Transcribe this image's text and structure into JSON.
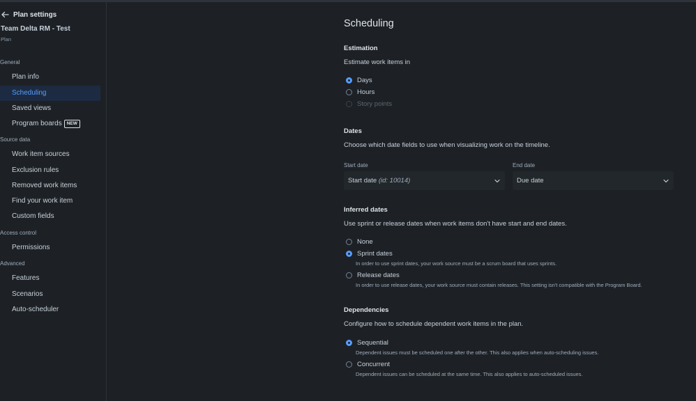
{
  "sidebar": {
    "back_label": "Plan settings",
    "plan_name": "Team Delta RM - Test",
    "plan_type": "Plan",
    "sections": [
      {
        "title": "General"
      },
      {
        "title": "Source data"
      },
      {
        "title": "Access control"
      },
      {
        "title": "Advanced"
      }
    ],
    "items": [
      {
        "label": "Plan info"
      },
      {
        "label": "Scheduling",
        "selected": true
      },
      {
        "label": "Saved views"
      },
      {
        "label": "Program boards",
        "badge": "NEW"
      },
      {
        "label": "Work item sources"
      },
      {
        "label": "Exclusion rules"
      },
      {
        "label": "Removed work items"
      },
      {
        "label": "Find your work item"
      },
      {
        "label": "Custom fields"
      },
      {
        "label": "Permissions"
      },
      {
        "label": "Features"
      },
      {
        "label": "Scenarios"
      },
      {
        "label": "Auto-scheduler"
      }
    ]
  },
  "main": {
    "title": "Scheduling",
    "estimation": {
      "heading": "Estimation",
      "description": "Estimate work items in",
      "options": [
        {
          "label": "Days",
          "checked": true
        },
        {
          "label": "Hours",
          "checked": false
        },
        {
          "label": "Story points",
          "checked": false,
          "disabled": true
        }
      ]
    },
    "dates": {
      "heading": "Dates",
      "description": "Choose which date fields to use when visualizing work on the timeline.",
      "start_label": "Start date",
      "start_value": "Start date",
      "start_value_id": "(id: 10014)",
      "end_label": "End date",
      "end_value": "Due date"
    },
    "inferred": {
      "heading": "Inferred dates",
      "description": "Use sprint or release dates when work items don't have start and end dates.",
      "options": [
        {
          "label": "None",
          "checked": false
        },
        {
          "label": "Sprint dates",
          "checked": true,
          "helper": "In order to use sprint dates, your work source must be a scrum board that uses sprints."
        },
        {
          "label": "Release dates",
          "checked": false,
          "helper": "In order to use release dates, your work source must contain releases. This setting isn't compatible with the Program Board."
        }
      ]
    },
    "dependencies": {
      "heading": "Dependencies",
      "description": "Configure how to schedule dependent work items in the plan.",
      "options": [
        {
          "label": "Sequential",
          "checked": true,
          "helper": "Dependent issues must be scheduled one after the other. This also applies when auto-scheduling issues."
        },
        {
          "label": "Concurrent",
          "checked": false,
          "helper": "Dependent issues can be scheduled at the same time. This also applies to auto-scheduled issues."
        }
      ]
    }
  },
  "colors": {
    "background": "#1d2125",
    "accent": "#579dff",
    "selected_bg": "#1c2b41",
    "field_bg": "#22272b"
  },
  "icons": {
    "back": "arrow-left-icon",
    "dropdown": "chevron-down-icon"
  }
}
